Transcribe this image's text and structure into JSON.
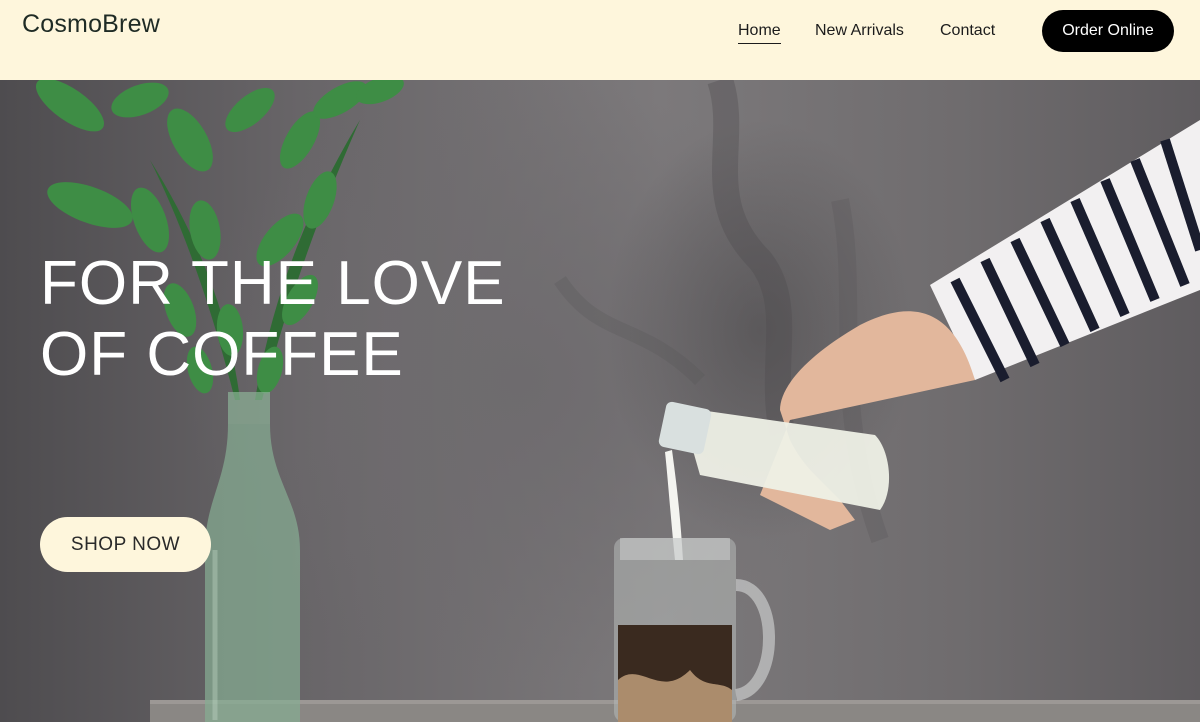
{
  "brand": {
    "name": "CosmoBrew"
  },
  "nav": {
    "items": [
      {
        "label": "Home",
        "active": true
      },
      {
        "label": "New Arrivals",
        "active": false
      },
      {
        "label": "Contact",
        "active": false
      }
    ],
    "order_button": "Order Online"
  },
  "hero": {
    "headline_line1": "FOR THE LOVE",
    "headline_line2": "OF COFFEE",
    "cta_label": "SHOP NOW",
    "image_description_icon": "coffee-pour-photo"
  },
  "colors": {
    "header_bg": "#fef6dc",
    "accent_dark": "#000000",
    "cta_bg": "#fef6dc",
    "headline_text": "#ffffff"
  }
}
